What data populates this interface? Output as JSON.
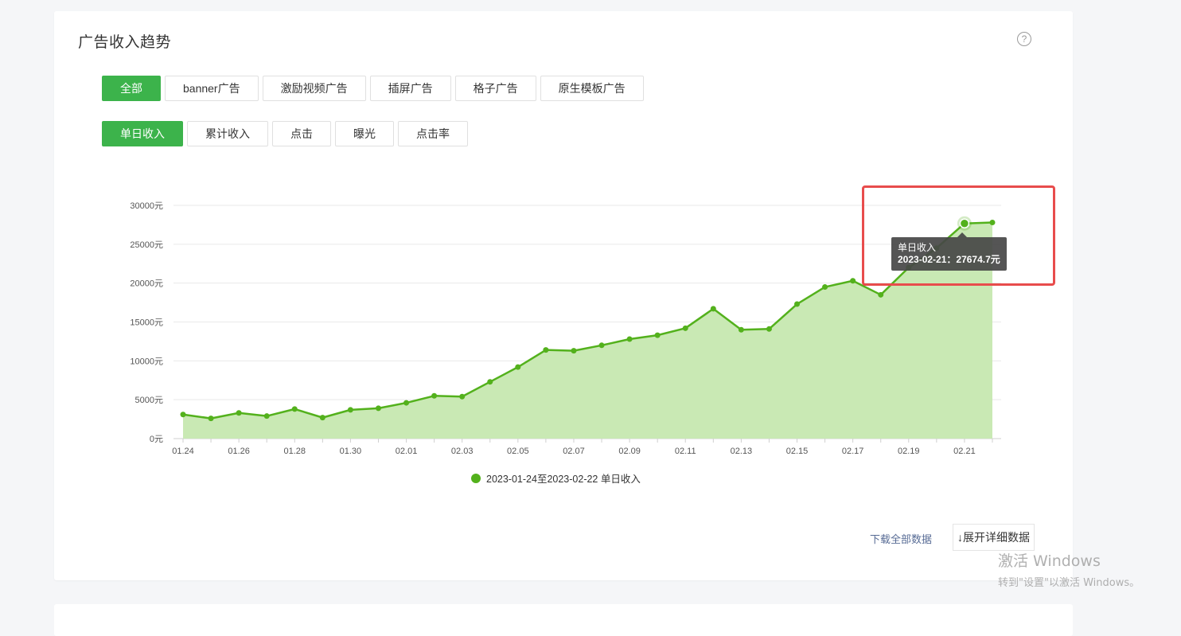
{
  "header": {
    "title": "广告收入趋势",
    "help_icon": "?"
  },
  "ad_type_tabs": [
    {
      "label": "全部",
      "active": true
    },
    {
      "label": "banner广告",
      "active": false
    },
    {
      "label": "激励视频广告",
      "active": false
    },
    {
      "label": "插屏广告",
      "active": false
    },
    {
      "label": "格子广告",
      "active": false
    },
    {
      "label": "原生模板广告",
      "active": false
    }
  ],
  "metric_tabs": [
    {
      "label": "单日收入",
      "active": true
    },
    {
      "label": "累计收入",
      "active": false
    },
    {
      "label": "点击",
      "active": false
    },
    {
      "label": "曝光",
      "active": false
    },
    {
      "label": "点击率",
      "active": false
    }
  ],
  "colors": {
    "accent": "#3cb34b",
    "series_line": "#53b11c",
    "series_fill": "#c9e9b4",
    "highlight_border": "#e84c4c",
    "link": "#576b95"
  },
  "chart_data": {
    "type": "area",
    "x": [
      "01.24",
      "01.25",
      "01.26",
      "01.27",
      "01.28",
      "01.29",
      "01.30",
      "01.31",
      "02.01",
      "02.02",
      "02.03",
      "02.04",
      "02.05",
      "02.06",
      "02.07",
      "02.08",
      "02.09",
      "02.10",
      "02.11",
      "02.12",
      "02.13",
      "02.14",
      "02.15",
      "02.16",
      "02.17",
      "02.18",
      "02.19",
      "02.20",
      "02.21",
      "02.22"
    ],
    "x_tick_labels": [
      "01.24",
      "01.26",
      "01.28",
      "01.30",
      "02.01",
      "02.03",
      "02.05",
      "02.07",
      "02.09",
      "02.11",
      "02.13",
      "02.15",
      "02.17",
      "02.19",
      "02.21"
    ],
    "series": [
      {
        "name": "2023-01-24至2023-02-22 单日收入",
        "values": [
          3100,
          2600,
          3300,
          2900,
          3800,
          2700,
          3700,
          3900,
          4600,
          5500,
          5400,
          7300,
          9200,
          11400,
          11300,
          12000,
          12800,
          13300,
          14200,
          16700,
          14000,
          14100,
          17300,
          19500,
          20300,
          18500,
          22000,
          24500,
          27674.7,
          27800
        ]
      }
    ],
    "y_ticks": [
      "0元",
      "5000元",
      "10000元",
      "15000元",
      "20000元",
      "25000元",
      "30000元"
    ],
    "ylim": [
      0,
      30000
    ],
    "grid": true,
    "legend_placement": "bottom-center",
    "tooltip": {
      "title": "单日收入",
      "date": "2023-02-21",
      "value": "27674.7元",
      "index": 28
    }
  },
  "footer": {
    "download_label": "下载全部数据",
    "expand_label": "↓展开详细数据"
  },
  "watermark": {
    "line1": "激活 Windows",
    "line2": "转到\"设置\"以激活 Windows。"
  }
}
